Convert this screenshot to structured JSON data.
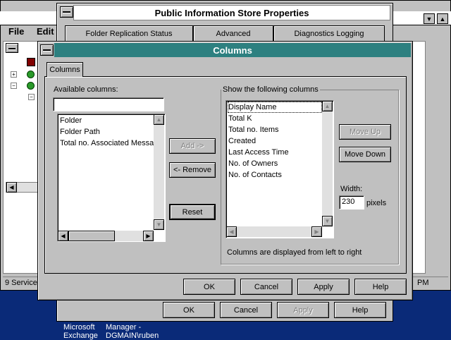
{
  "background_window": {
    "menu": [
      "File",
      "Edit"
    ],
    "status_left": "9 Service",
    "status_right": "PM"
  },
  "desktop": {
    "icon_label_1": "Microsoft\nExchange",
    "icon_label_2": "Manager -\nDGMAIN\\ruben"
  },
  "properties_dialog": {
    "title": "Public Information Store Properties",
    "tabs": [
      "Folder Replication Status",
      "Advanced",
      "Diagnostics Logging"
    ],
    "ok": "OK",
    "cancel": "Cancel",
    "apply": "Apply",
    "help": "Help"
  },
  "columns_dialog": {
    "title": "Columns",
    "tab": "Columns",
    "available_label": "Available columns:",
    "available_filter": "",
    "available_items": [
      "Folder",
      "Folder Path",
      "Total no. Associated Messa"
    ],
    "add_button": "Add ->",
    "remove_button": "<- Remove",
    "reset_button": "Reset",
    "show_label": "Show the following columns",
    "shown_items": [
      "Display Name",
      "Total K",
      "Total no. Items",
      "Created",
      "Last Access Time",
      "No. of Owners",
      "No. of Contacts"
    ],
    "move_up": "Move Up",
    "move_down": "Move Down",
    "width_label": "Width:",
    "width_value": "230",
    "pixels_label": "pixels",
    "footer_note": "Columns are displayed from left to right",
    "ok": "OK",
    "cancel": "Cancel",
    "apply": "Apply",
    "help": "Help"
  },
  "colors": {
    "desktop": "#0a2a78",
    "dialog_face": "#c0c0c0",
    "active_title": "#2d8080",
    "inactive_title": "#ffffff"
  }
}
